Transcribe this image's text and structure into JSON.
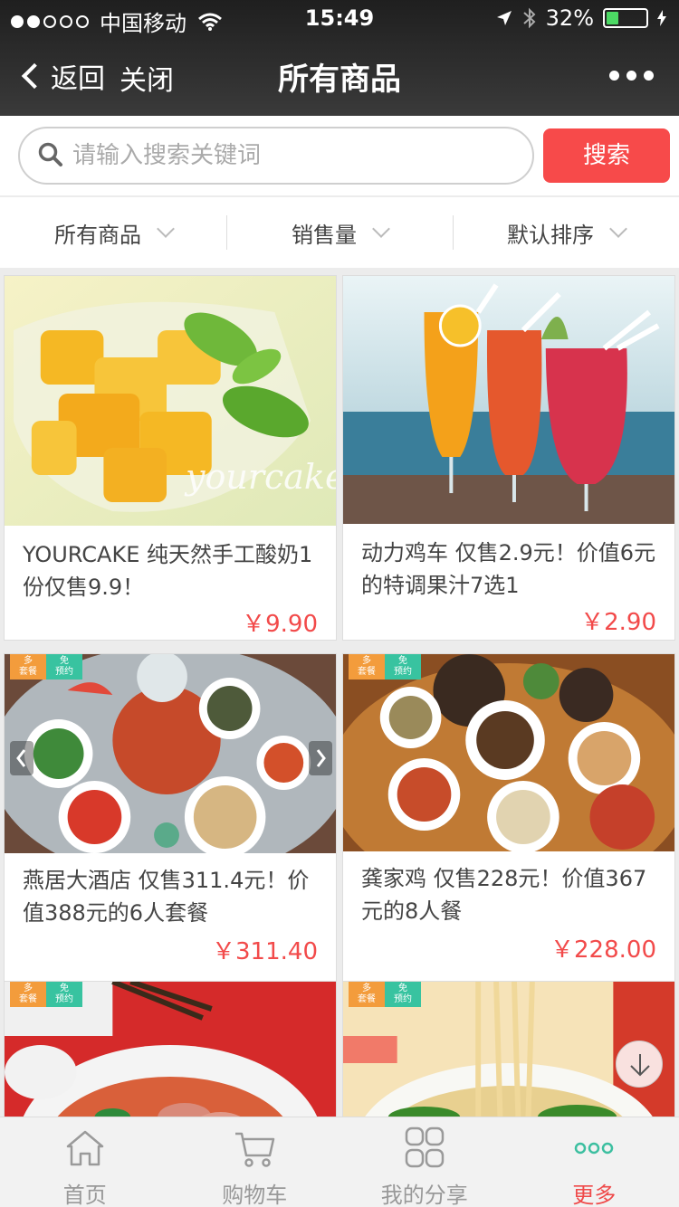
{
  "status": {
    "carrier": "中国移动",
    "time": "15:49",
    "battery": "32%",
    "battery_level": 0.32
  },
  "nav": {
    "back_label": "返回",
    "close_label": "关闭",
    "title": "所有商品"
  },
  "search": {
    "placeholder": "请输入搜索关键词",
    "button_label": "搜索"
  },
  "filters": [
    {
      "label": "所有商品"
    },
    {
      "label": "销售量"
    },
    {
      "label": "默认排序"
    }
  ],
  "tags": {
    "combo": "多\n套餐",
    "free": "免\n预约"
  },
  "products": [
    {
      "title": "YOURCAKE 纯天然手工酸奶1份仅售9.9！",
      "price": "￥9.90",
      "watermark": "yourcake"
    },
    {
      "title": "动力鸡车 仅售2.9元！价值6元的特调果汁7选1",
      "price": "￥2.90"
    },
    {
      "title": "燕居大酒店 仅售311.4元！价值388元的6人套餐",
      "price": "￥311.40"
    },
    {
      "title": "龚家鸡 仅售228元！价值367元的8人餐",
      "price": "￥228.00"
    }
  ],
  "tabbar": [
    {
      "label": "首页",
      "icon": "home-icon"
    },
    {
      "label": "购物车",
      "icon": "cart-icon"
    },
    {
      "label": "我的分享",
      "icon": "grid-icon"
    },
    {
      "label": "更多",
      "icon": "more-dots-icon"
    }
  ],
  "colors": {
    "accent": "#f74a4a",
    "tag_orange": "#f39c3c",
    "tag_teal": "#38c3a0",
    "more_icon": "#3cbfa0"
  }
}
